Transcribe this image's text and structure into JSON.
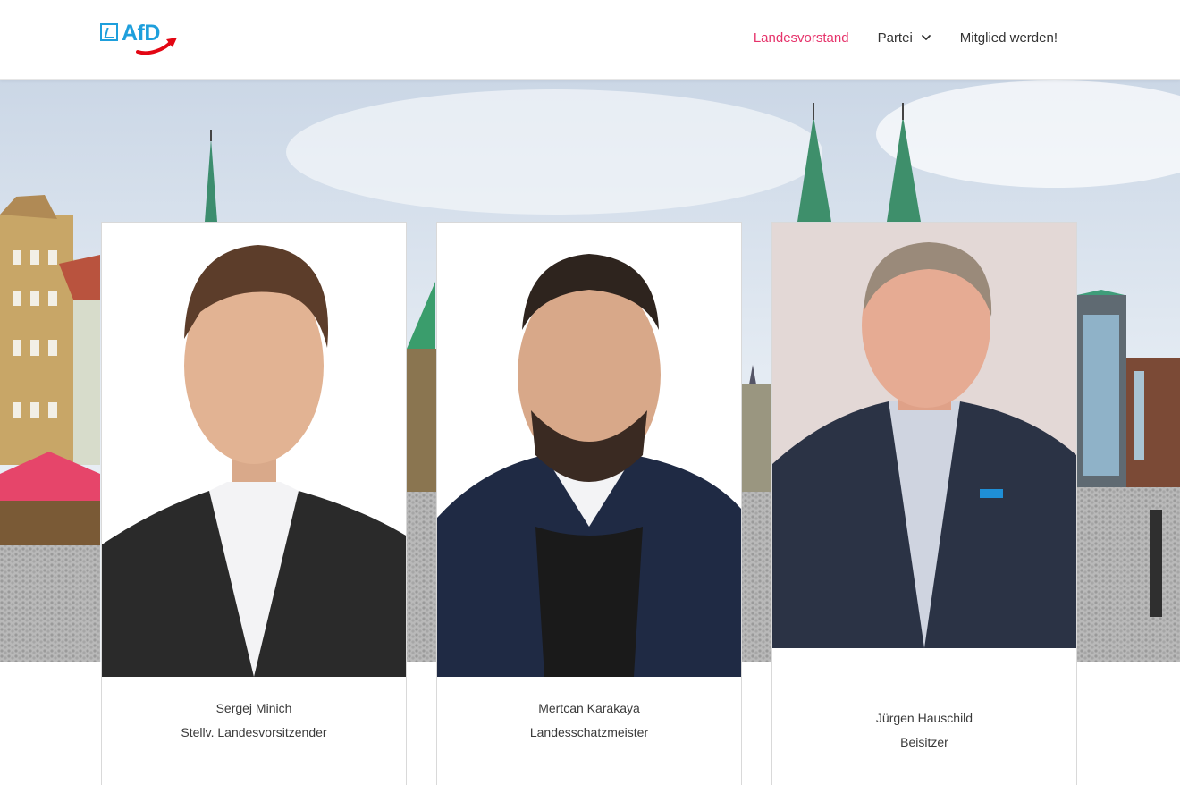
{
  "header": {
    "logo_text": "AfD",
    "nav": [
      {
        "label": "Landesvorstand",
        "active": true
      },
      {
        "label": "Partei",
        "has_dropdown": true
      },
      {
        "label": "Mitglied werden!"
      }
    ]
  },
  "colors": {
    "accent": "#e6336b",
    "logo_blue": "#1e9fdc",
    "logo_red": "#e30613",
    "text": "#333333"
  },
  "board_members": [
    {
      "name": "Sergej Minich",
      "role": "Stellv. Landesvorsitzender"
    },
    {
      "name": "Mertcan Karakaya",
      "role": "Landesschatzmeister"
    },
    {
      "name": "Jürgen Hauschild",
      "role": "Beisitzer"
    }
  ]
}
